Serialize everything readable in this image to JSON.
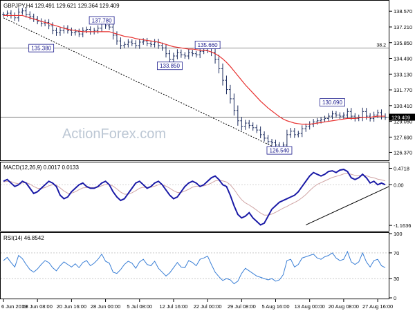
{
  "chart_data": [
    {
      "type": "line",
      "pane": "price",
      "header": "GBPJPY,H4  129.491 129.621 129.364 129.409",
      "watermark": "ActionForex.com",
      "ylim": [
        125.8,
        139.3
      ],
      "y_ticks": [
        "138.570",
        "137.210",
        "135.850",
        "134.490",
        "133.130",
        "131.770",
        "130.410",
        "129.050",
        "127.690",
        "126.370"
      ],
      "y_tick_values": [
        138.57,
        137.21,
        135.85,
        134.49,
        133.13,
        131.77,
        130.41,
        129.05,
        127.69,
        126.37
      ],
      "last_price_label": "129.409",
      "last_price": 129.409,
      "horizontal_levels": [
        {
          "value": 135.38,
          "label": "38.2"
        },
        {
          "value": 129.409,
          "label": ""
        }
      ],
      "annotations": [
        {
          "label": "137.780",
          "x": 26,
          "y": 137.78
        },
        {
          "label": "135.380",
          "x": 10,
          "y": 135.38
        },
        {
          "label": "135.660",
          "x": 54,
          "y": 135.66
        },
        {
          "label": "133.850",
          "x": 44,
          "y": 133.85
        },
        {
          "label": "130.690",
          "x": 87,
          "y": 130.69
        },
        {
          "label": "126.540",
          "x": 73,
          "y": 126.54
        }
      ],
      "trendline": {
        "x": [
          0,
          73
        ],
        "y": [
          138.0,
          126.6
        ]
      },
      "x_ticks": [
        "6 Jun 2019",
        "13 Jun 08:00",
        "20 Jun 16:00",
        "28 Jun 00:00",
        "5 Jul 08:00",
        "12 Jul 16:00",
        "22 Jul 00:00",
        "29 Jul 08:00",
        "5 Aug 16:00",
        "13 Aug 00:00",
        "20 Aug 08:00",
        "27 Aug 16:00"
      ],
      "x_tick_positions": [
        0,
        9,
        18,
        27,
        36,
        45,
        54,
        63,
        72,
        81,
        90,
        99
      ],
      "series": [
        {
          "style": "price-bars",
          "close": [
            138.3,
            138.4,
            138.2,
            138.0,
            138.5,
            138.6,
            138.3,
            138.1,
            137.9,
            137.7,
            137.5,
            137.6,
            137.3,
            136.9,
            136.7,
            136.9,
            137.1,
            136.9,
            136.7,
            136.8,
            136.6,
            136.9,
            137.0,
            136.8,
            136.9,
            137.1,
            137.5,
            137.3,
            137.2,
            136.5,
            136.0,
            135.6,
            135.7,
            135.9,
            135.8,
            135.6,
            135.9,
            136.0,
            135.8,
            135.7,
            135.9,
            135.6,
            135.4,
            134.9,
            134.4,
            134.7,
            135.0,
            134.8,
            134.7,
            135.0,
            134.9,
            134.8,
            135.1,
            135.2,
            135.4,
            135.0,
            134.4,
            133.6,
            132.6,
            131.8,
            131.0,
            130.0,
            129.1,
            128.6,
            128.9,
            128.7,
            128.5,
            128.3,
            127.9,
            127.6,
            127.3,
            127.2,
            127.0,
            126.8,
            127.0,
            127.9,
            128.2,
            127.9,
            128.0,
            128.4,
            128.6,
            128.8,
            129.0,
            129.1,
            129.2,
            129.3,
            129.5,
            129.7,
            129.6,
            129.5,
            129.6,
            129.9,
            129.5,
            129.3,
            129.4,
            129.9,
            129.5,
            129.3,
            129.6,
            129.8,
            129.5,
            129.4
          ]
        },
        {
          "style": "moving-average",
          "color": "#e8312f",
          "values": [
            138.2,
            138.2,
            138.2,
            138.2,
            138.2,
            138.2,
            138.1,
            138.0,
            137.9,
            137.8,
            137.7,
            137.6,
            137.5,
            137.4,
            137.3,
            137.2,
            137.1,
            137.0,
            136.95,
            136.9,
            136.85,
            136.8,
            136.8,
            136.8,
            136.8,
            136.8,
            136.8,
            136.8,
            136.8,
            136.7,
            136.6,
            136.5,
            136.4,
            136.35,
            136.3,
            136.2,
            136.15,
            136.1,
            136.05,
            136.0,
            135.95,
            135.9,
            135.8,
            135.7,
            135.6,
            135.5,
            135.45,
            135.4,
            135.35,
            135.3,
            135.3,
            135.25,
            135.2,
            135.2,
            135.15,
            135.05,
            134.9,
            134.7,
            134.45,
            134.15,
            133.8,
            133.4,
            133.0,
            132.6,
            132.2,
            131.85,
            131.5,
            131.15,
            130.8,
            130.5,
            130.2,
            129.95,
            129.7,
            129.45,
            129.25,
            129.1,
            129.0,
            128.9,
            128.85,
            128.8,
            128.8,
            128.8,
            128.85,
            128.9,
            128.95,
            129.0,
            129.05,
            129.1,
            129.15,
            129.2,
            129.25,
            129.3,
            129.3,
            129.3,
            129.35,
            129.4,
            129.4,
            129.4,
            129.45,
            129.5,
            129.5,
            129.5
          ]
        }
      ]
    },
    {
      "type": "line",
      "pane": "macd",
      "header": "MACD(12,26,9) 0.0017 0.0133",
      "ylim": [
        -1.3,
        0.62
      ],
      "y_ticks": [
        "0.4718",
        "0.00",
        "-1.1636"
      ],
      "y_tick_values": [
        0.4718,
        0.0,
        -1.1636
      ],
      "trendline": {
        "x": [
          80,
          102
        ],
        "y": [
          -1.15,
          -0.05
        ]
      },
      "series": [
        {
          "name": "MACD",
          "color": "#1a1aa6",
          "values": [
            0.1,
            0.15,
            0.05,
            -0.05,
            0.0,
            0.1,
            0.05,
            -0.1,
            -0.25,
            -0.2,
            -0.1,
            0.0,
            0.1,
            0.05,
            -0.05,
            -0.3,
            -0.4,
            -0.35,
            -0.2,
            -0.1,
            0.0,
            0.05,
            -0.05,
            -0.1,
            -0.1,
            -0.05,
            0.05,
            0.1,
            0.0,
            -0.2,
            -0.35,
            -0.45,
            -0.4,
            -0.25,
            -0.1,
            0.05,
            0.1,
            0.0,
            -0.1,
            -0.05,
            0.05,
            0.1,
            0.0,
            -0.15,
            -0.3,
            -0.4,
            -0.35,
            -0.2,
            -0.05,
            0.05,
            0.1,
            0.05,
            -0.05,
            0.0,
            0.1,
            0.2,
            0.25,
            0.15,
            0.0,
            -0.05,
            -0.3,
            -0.6,
            -0.85,
            -0.95,
            -0.9,
            -0.8,
            -0.95,
            -1.05,
            -1.15,
            -1.1,
            -0.9,
            -0.7,
            -0.6,
            -0.5,
            -0.45,
            -0.4,
            -0.35,
            -0.3,
            -0.2,
            -0.05,
            0.1,
            0.25,
            0.35,
            0.3,
            0.25,
            0.3,
            0.38,
            0.4,
            0.35,
            0.42,
            0.44,
            0.38,
            0.2,
            0.15,
            0.2,
            0.3,
            0.2,
            0.05,
            0.1,
            0.0,
            0.05,
            0.0
          ]
        },
        {
          "name": "Signal",
          "color": "#d0a5a5",
          "values": [
            0.08,
            0.1,
            0.09,
            0.05,
            0.03,
            0.05,
            0.06,
            0.02,
            -0.05,
            -0.1,
            -0.11,
            -0.08,
            -0.03,
            0.0,
            -0.01,
            -0.09,
            -0.18,
            -0.24,
            -0.24,
            -0.2,
            -0.14,
            -0.09,
            -0.08,
            -0.08,
            -0.08,
            -0.07,
            -0.03,
            0.01,
            0.01,
            -0.04,
            -0.12,
            -0.21,
            -0.27,
            -0.27,
            -0.23,
            -0.17,
            -0.1,
            -0.07,
            -0.08,
            -0.07,
            -0.04,
            0.0,
            0.0,
            -0.04,
            -0.1,
            -0.17,
            -0.22,
            -0.22,
            -0.18,
            -0.13,
            -0.07,
            -0.04,
            -0.04,
            -0.03,
            0.0,
            0.05,
            0.11,
            0.13,
            0.11,
            0.08,
            0.0,
            -0.13,
            -0.29,
            -0.43,
            -0.52,
            -0.58,
            -0.65,
            -0.73,
            -0.81,
            -0.87,
            -0.87,
            -0.84,
            -0.79,
            -0.73,
            -0.67,
            -0.62,
            -0.56,
            -0.51,
            -0.45,
            -0.37,
            -0.28,
            -0.17,
            -0.07,
            0.01,
            0.06,
            0.11,
            0.16,
            0.21,
            0.24,
            0.27,
            0.31,
            0.32,
            0.3,
            0.27,
            0.26,
            0.27,
            0.26,
            0.22,
            0.2,
            0.16,
            0.14,
            0.11
          ]
        }
      ]
    },
    {
      "type": "line",
      "pane": "rsi",
      "header": "RSI(14) 46.8542",
      "ylim": [
        0,
        100
      ],
      "y_ticks": [
        "100",
        "70",
        "30",
        "0"
      ],
      "y_tick_values": [
        100,
        70,
        30,
        0
      ],
      "levels": [
        70,
        30
      ],
      "series": [
        {
          "name": "RSI(14)",
          "color": "#3a7fd6",
          "values": [
            58,
            63,
            55,
            48,
            66,
            61,
            52,
            44,
            40,
            45,
            52,
            58,
            55,
            47,
            42,
            50,
            56,
            52,
            48,
            53,
            47,
            55,
            58,
            50,
            54,
            60,
            68,
            57,
            54,
            40,
            38,
            44,
            52,
            57,
            54,
            46,
            56,
            60,
            52,
            50,
            57,
            46,
            40,
            34,
            39,
            47,
            55,
            48,
            47,
            58,
            55,
            50,
            60,
            62,
            65,
            52,
            40,
            33,
            27,
            30,
            28,
            22,
            26,
            38,
            46,
            42,
            38,
            34,
            32,
            30,
            28,
            30,
            26,
            28,
            36,
            58,
            60,
            48,
            52,
            62,
            64,
            66,
            68,
            62,
            60,
            64,
            66,
            70,
            62,
            58,
            60,
            72,
            56,
            52,
            56,
            70,
            56,
            48,
            58,
            60,
            50,
            47
          ]
        }
      ]
    }
  ]
}
